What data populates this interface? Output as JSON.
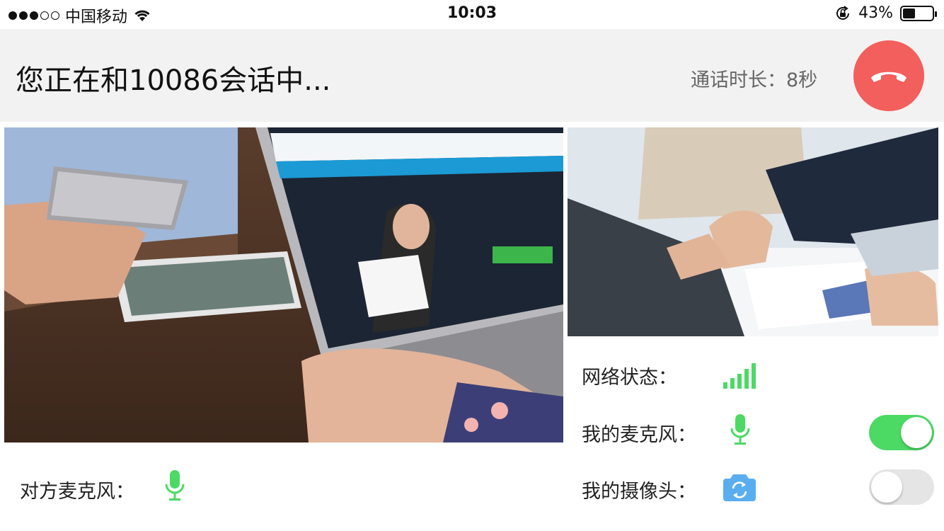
{
  "status_bar": {
    "signal_dots_filled": 3,
    "signal_dots_total": 5,
    "carrier": "中国移动",
    "time": "10:03",
    "battery_percent": "43%",
    "battery_level": 0.43
  },
  "header": {
    "title": "您正在和10086会话中...",
    "duration_text": "通话时长：8秒",
    "hangup_icon": "phone-hangup-icon",
    "hangup_color": "#f25f5c"
  },
  "controls": {
    "network_label": "网络状态：",
    "network_icon": "signal-bars-icon",
    "network_level": 5,
    "my_mic_label": "我的麦克风：",
    "my_mic_icon": "microphone-icon",
    "my_mic_on": true,
    "my_camera_label": "我的摄像头：",
    "my_camera_icon": "camera-switch-icon",
    "my_camera_on": false,
    "remote_mic_label": "对方麦克风：",
    "remote_mic_icon": "microphone-icon"
  },
  "colors": {
    "accent_green": "#4cd964",
    "mic_green": "#4cd964",
    "camera_blue": "#5aaef0",
    "header_bg": "#f2f2f2"
  }
}
